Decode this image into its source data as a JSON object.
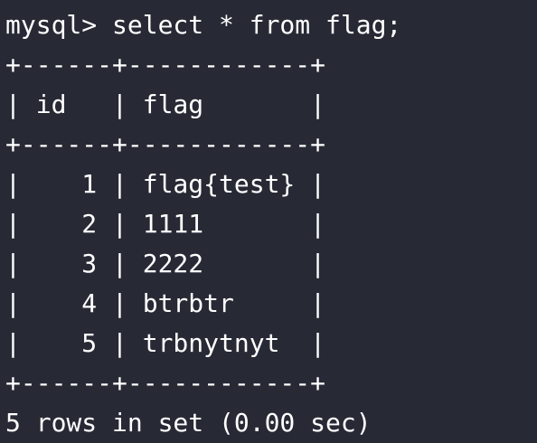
{
  "terminal": {
    "lines": [
      "mysql> select * from flag;",
      "+------+------------+",
      "| id   | flag       |",
      "+------+------------+",
      "|    1 | flag{test} |",
      "|    2 | 1111       |",
      "|    3 | 2222       |",
      "|    4 | btrbtr     |",
      "|    5 | trbnytnyt  |",
      "+------+------------+",
      "5 rows in set (0.00 sec)"
    ]
  },
  "colors": {
    "background": "#272a35",
    "text": "#ffffff"
  }
}
